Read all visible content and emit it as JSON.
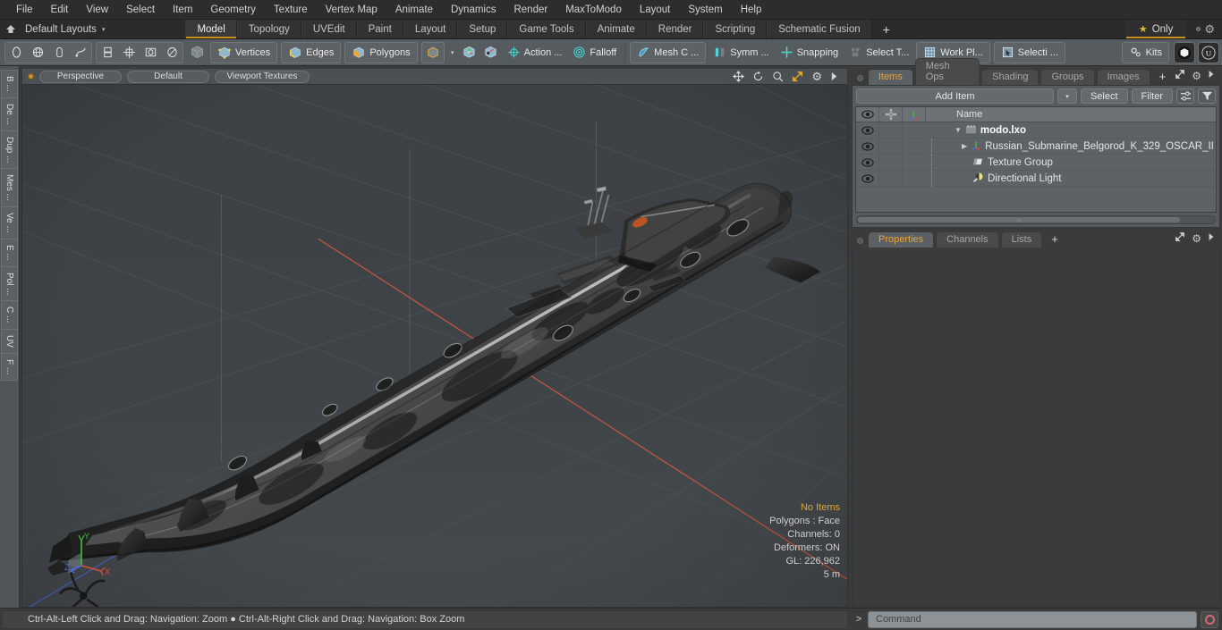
{
  "app": {
    "title": "modo",
    "accent": "#c8921f",
    "viewport_bg": "#3e4347"
  },
  "menubar": {
    "items": [
      "File",
      "Edit",
      "View",
      "Select",
      "Item",
      "Geometry",
      "Texture",
      "Vertex Map",
      "Animate",
      "Dynamics",
      "Render",
      "MaxToModo",
      "Layout",
      "System",
      "Help"
    ]
  },
  "layoutbar": {
    "home_icon": "home-icon",
    "layout_label": "Default Layouts",
    "caret": "▾",
    "tabs": [
      {
        "label": "Model",
        "active": true
      },
      {
        "label": "Topology",
        "active": false
      },
      {
        "label": "UVEdit",
        "active": false
      },
      {
        "label": "Paint",
        "active": false
      },
      {
        "label": "Layout",
        "active": false
      },
      {
        "label": "Setup",
        "active": false
      },
      {
        "label": "Game Tools",
        "active": false
      },
      {
        "label": "Animate",
        "active": false
      },
      {
        "label": "Render",
        "active": false
      },
      {
        "label": "Scripting",
        "active": false
      },
      {
        "label": "Schematic Fusion",
        "active": false
      }
    ],
    "add_tab": "+",
    "only_label": "Only",
    "only_star": "★",
    "gear_icon": "gear-icon"
  },
  "toolbar": {
    "primitives": [
      "circle-icon",
      "globe-icon",
      "pen-icon",
      "curve-icon"
    ],
    "transforms": [
      "mirror-icon",
      "center-icon",
      "box-icon",
      "ellipse-icon"
    ],
    "mesh_cube": "cube-icon",
    "selection_modes": [
      {
        "label": "Vertices",
        "icon": "vertices-icon"
      },
      {
        "label": "Edges",
        "icon": "edges-icon"
      },
      {
        "label": "Polygons",
        "icon": "polygons-icon"
      }
    ],
    "items_mode_icon": "items-cube-icon",
    "mode_caret": "▾",
    "pivot_icons": [
      "center-pivot-icon",
      "selection-pivot-icon"
    ],
    "buttons": [
      {
        "label": "Action   ...",
        "icon": "action-center-icon",
        "dim": false
      },
      {
        "label": "Falloff",
        "icon": "falloff-icon",
        "dim": false
      },
      {
        "label": "Mesh C ...",
        "icon": "mesh-constraint-icon",
        "dim": false
      },
      {
        "label": "Symm ...",
        "icon": "symmetry-icon",
        "dim": false
      },
      {
        "label": "Snapping",
        "icon": "snapping-icon",
        "dim": false
      },
      {
        "label": "Select T...",
        "icon": "select-through-icon",
        "dim": true
      },
      {
        "label": "Work Pl...",
        "icon": "work-plane-icon",
        "dim": false
      },
      {
        "label": "Selecti ...",
        "icon": "selection-set-icon",
        "dim": false
      }
    ],
    "kits_label": "Kits",
    "kits_icon": "gears-icon",
    "right_badges": [
      "substance-icon",
      "unreal-icon"
    ]
  },
  "left_vtabs": [
    "B ...",
    "De ...",
    "Dup ...",
    "Mes ...",
    "Ve ...",
    "E ...",
    "Pol ...",
    "C ...",
    "UV",
    "F ..."
  ],
  "viewport": {
    "dot": "active-indicator",
    "pills": [
      "Perspective",
      "Default",
      "Viewport Textures"
    ],
    "tools": [
      "move-icon",
      "rotate-icon",
      "zoom-icon",
      "fit-icon",
      "gear-icon",
      "arrow-icon"
    ],
    "hud": {
      "no_items": "No Items",
      "polygons": "Polygons : Face",
      "channels": "Channels: 0",
      "deformers": "Deformers: ON",
      "gl": "GL: 226,962",
      "scale": "5 m"
    },
    "axes": {
      "x": "X",
      "y": "Y",
      "z": "Z",
      "x_color": "#e04b3c",
      "y_color": "#3fc23f",
      "z_color": "#4a6ee0"
    }
  },
  "right_panel": {
    "top_tabs": [
      {
        "label": "Items",
        "active": true
      },
      {
        "label": "Mesh Ops",
        "active": false
      },
      {
        "label": "Shading",
        "active": false
      },
      {
        "label": "Groups",
        "active": false
      },
      {
        "label": "Images",
        "active": false
      },
      {
        "label": "+",
        "active": false
      }
    ],
    "top_tab_right_icons": [
      "expand-icon",
      "gear-icon",
      "arrow-icon"
    ],
    "add_item_label": "Add Item",
    "add_item_caret": "▾",
    "select_label": "Select",
    "filter_label": "Filter",
    "filter_icons": [
      "list-filter-icon",
      "funnel-icon"
    ],
    "tree_headers": {
      "eye": "eye-icon",
      "lock": "lock-icon",
      "axis": "axis-icon",
      "name": "Name"
    },
    "tree_rows": [
      {
        "name": "modo.lxo",
        "icon": "scene-icon",
        "depth": 0,
        "bold": true,
        "expander": "▼",
        "eye": true
      },
      {
        "name": "Russian_Submarine_Belgorod_K_329_OSCAR_II",
        "icon": "mesh-axis-icon",
        "depth": 1,
        "bold": false,
        "expander": "▶",
        "eye": true
      },
      {
        "name": "Texture Group",
        "icon": "texture-group-icon",
        "depth": 1,
        "bold": false,
        "expander": "",
        "eye": true
      },
      {
        "name": "Directional Light",
        "icon": "light-icon",
        "depth": 1,
        "bold": false,
        "expander": "",
        "eye": true
      }
    ],
    "bottom_tabs": [
      {
        "label": "Properties",
        "active": true
      },
      {
        "label": "Channels",
        "active": false
      },
      {
        "label": "Lists",
        "active": false
      },
      {
        "label": "+",
        "active": false
      }
    ],
    "bottom_tab_right_icons": [
      "expand-icon",
      "gear-icon",
      "arrow-icon"
    ]
  },
  "statusbar": {
    "message": "Ctrl-Alt-Left Click and Drag: Navigation: Zoom ● Ctrl-Alt-Right Click and Drag: Navigation: Box Zoom",
    "command_arrow": ">",
    "command_placeholder": "Command",
    "record_icon": "record-icon"
  }
}
